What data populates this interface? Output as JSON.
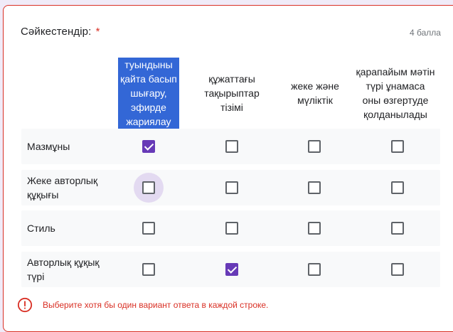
{
  "question": {
    "title": "Сәйкестендір:",
    "required_mark": "*",
    "points": "4 балла"
  },
  "columns": [
    {
      "label": "туындыны қайта басып шығару, эфирде жариялау",
      "selected_text": true
    },
    {
      "label": "құжаттағы тақырыптар тізімі",
      "selected_text": false
    },
    {
      "label": "жеке және мүліктік",
      "selected_text": false
    },
    {
      "label": "қарапайым мәтін түрі ұнамаса оны өзгертуде қолданылады",
      "selected_text": false
    }
  ],
  "rows": [
    {
      "label": "Мазмұны",
      "checked": [
        true,
        false,
        false,
        false
      ]
    },
    {
      "label": "Жеке авторлық құқығы",
      "checked": [
        false,
        false,
        false,
        false
      ],
      "focused_col": 0
    },
    {
      "label": "Стиль",
      "checked": [
        false,
        false,
        false,
        false
      ]
    },
    {
      "label": "Авторлық құқық түрі",
      "checked": [
        false,
        true,
        false,
        false
      ]
    }
  ],
  "error": {
    "icon": "error-circle-icon",
    "text": "Выберите хотя бы один вариант ответа в каждой строке."
  },
  "colors": {
    "accent": "#673ab7",
    "error": "#d93025",
    "text_selection": "#3367d6"
  }
}
